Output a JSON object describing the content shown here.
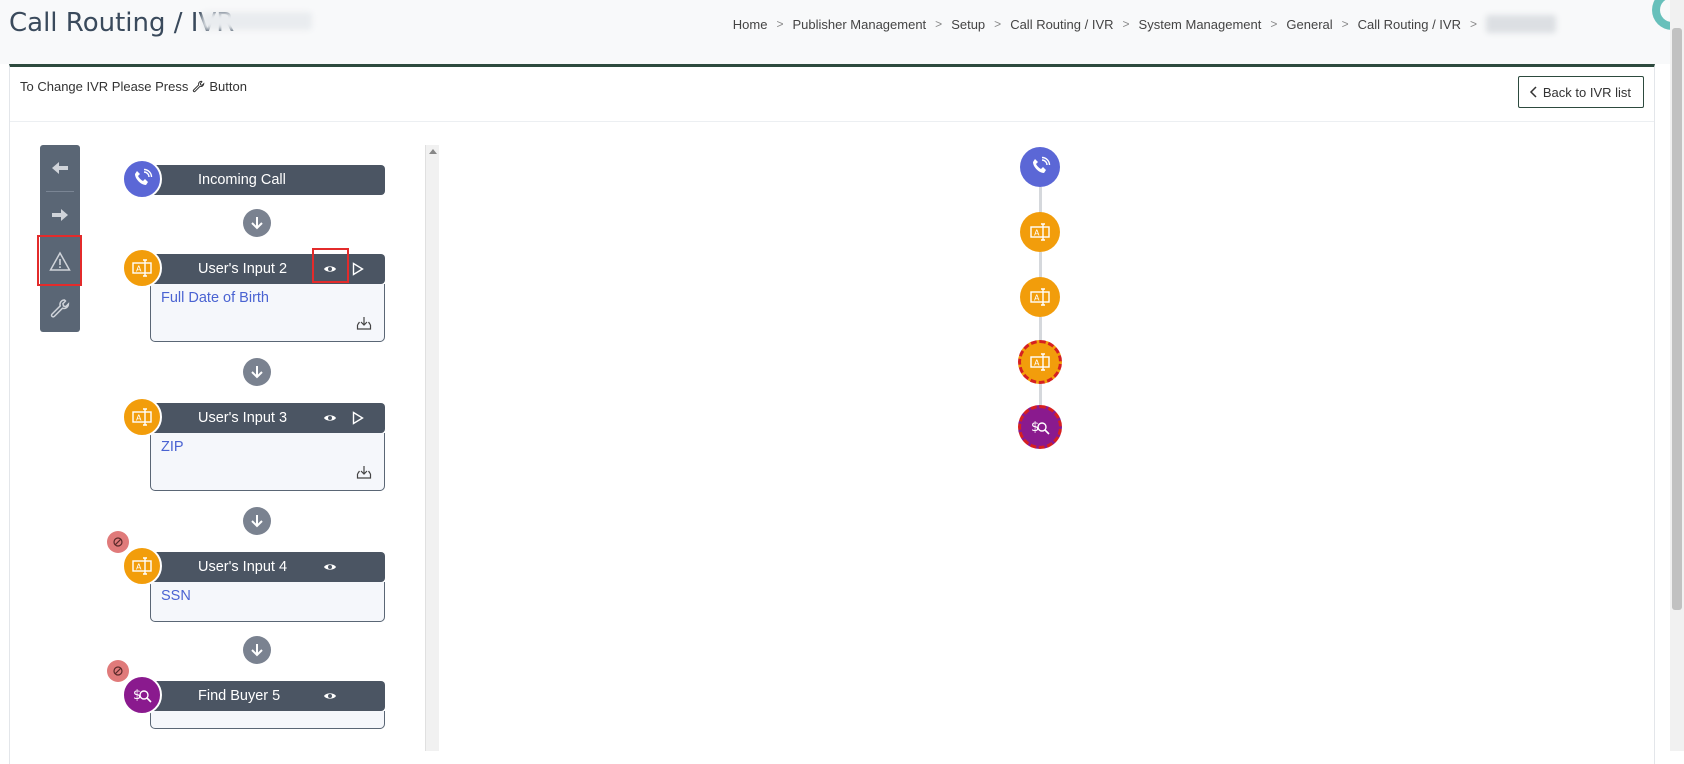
{
  "header": {
    "title": "Call Routing / IVR",
    "breadcrumb": [
      "Home",
      "Publisher Management",
      "Setup",
      "Call Routing / IVR",
      "System Management",
      "General",
      "Call Routing / IVR"
    ],
    "breadcrumb_sep": ">"
  },
  "card": {
    "hint_before": "To Change IVR Please Press",
    "hint_after": "Button",
    "back_label": "Back to IVR list"
  },
  "toolbar": {
    "items": [
      "arrow-left-icon",
      "arrow-right-icon",
      "warning-icon",
      "wrench-icon"
    ]
  },
  "flow": {
    "nodes": [
      {
        "title": "Incoming Call",
        "subtitle": "",
        "type": "incoming"
      },
      {
        "title": "User's Input 2",
        "subtitle": "Full Date of Birth",
        "type": "input"
      },
      {
        "title": "User's Input 3",
        "subtitle": "ZIP",
        "type": "input"
      },
      {
        "title": "User's Input 4",
        "subtitle": "SSN",
        "type": "input",
        "disabled": true
      },
      {
        "title": "Find Buyer 5",
        "subtitle": "",
        "type": "buyer",
        "disabled": true
      }
    ]
  },
  "colors": {
    "incoming": "#5b67d6",
    "input": "#f29d0b",
    "buyer": "#8a1a8e",
    "header_bg": "#4b5563",
    "accent_border": "#2d4a3e",
    "highlight": "#e32b2b"
  }
}
